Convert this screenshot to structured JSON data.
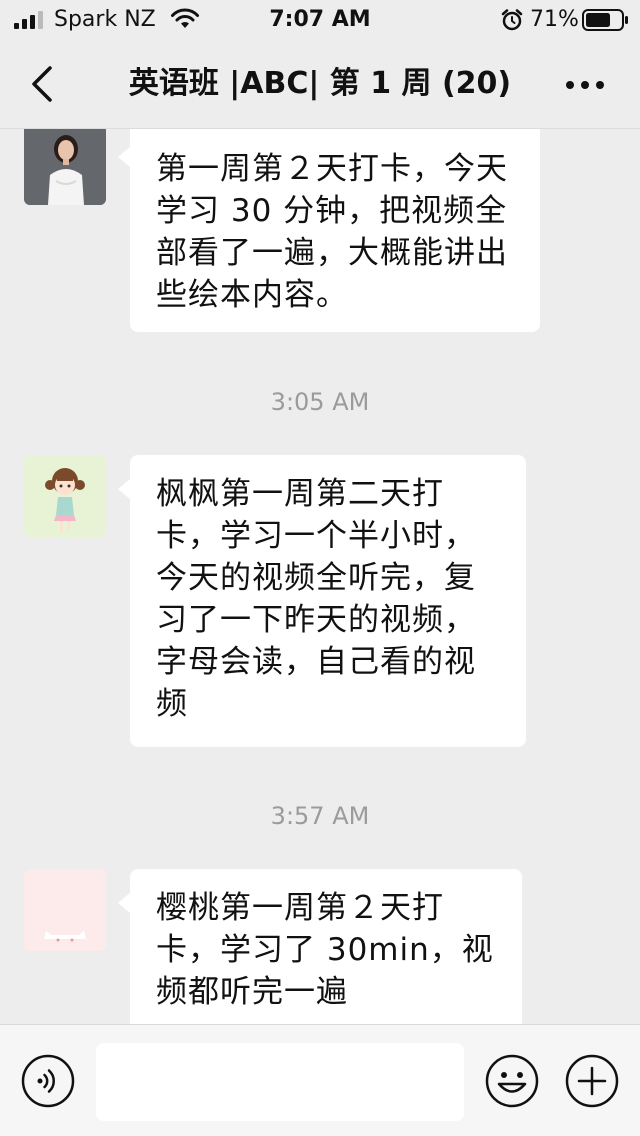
{
  "status_bar": {
    "carrier": "Spark NZ",
    "time": "7:07 AM",
    "battery_percent": "71%",
    "icons": [
      "signal-icon",
      "wifi-icon",
      "alarm-icon",
      "battery-icon"
    ]
  },
  "nav": {
    "title": "英语班 |ABC| 第 1 周 (20)",
    "back_icon": "chevron-left-icon",
    "more_icon": "more-dots-icon"
  },
  "messages": [
    {
      "type": "text",
      "avatar": "avatar-woman-photo",
      "text": "第一周第２天打卡，今天学习 30 分钟，把视频全部看了一遍，大概能讲出些绘本内容。"
    },
    {
      "type": "time",
      "text": "3:05 AM"
    },
    {
      "type": "text",
      "avatar": "avatar-cartoon-girl",
      "text": "枫枫第一周第二天打卡，学习一个半小时，今天的视频全听完，复习了一下昨天的视频，字母会读，自己看的视频"
    },
    {
      "type": "time",
      "text": "3:57 AM"
    },
    {
      "type": "text",
      "avatar": "avatar-pink-cat",
      "text": "樱桃第一周第２天打卡，学习了 30min，视频都听完一遍"
    }
  ],
  "input_bar": {
    "message_value": "",
    "voice_icon": "voice-icon",
    "emoji_icon": "emoji-icon",
    "plus_icon": "plus-icon"
  },
  "colors": {
    "background": "#ededed",
    "bubble": "#ffffff",
    "timestamp": "#9b9b9b",
    "input_bar": "#f6f6f6"
  }
}
